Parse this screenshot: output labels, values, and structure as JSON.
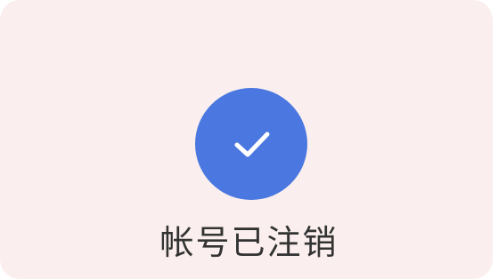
{
  "dialog": {
    "icon": "checkmark-circle-icon",
    "status_text": "帐号已注销"
  },
  "colors": {
    "background": "#faefee",
    "accent": "#4a77e0",
    "check_stroke": "#ffffff",
    "text": "#333333"
  }
}
